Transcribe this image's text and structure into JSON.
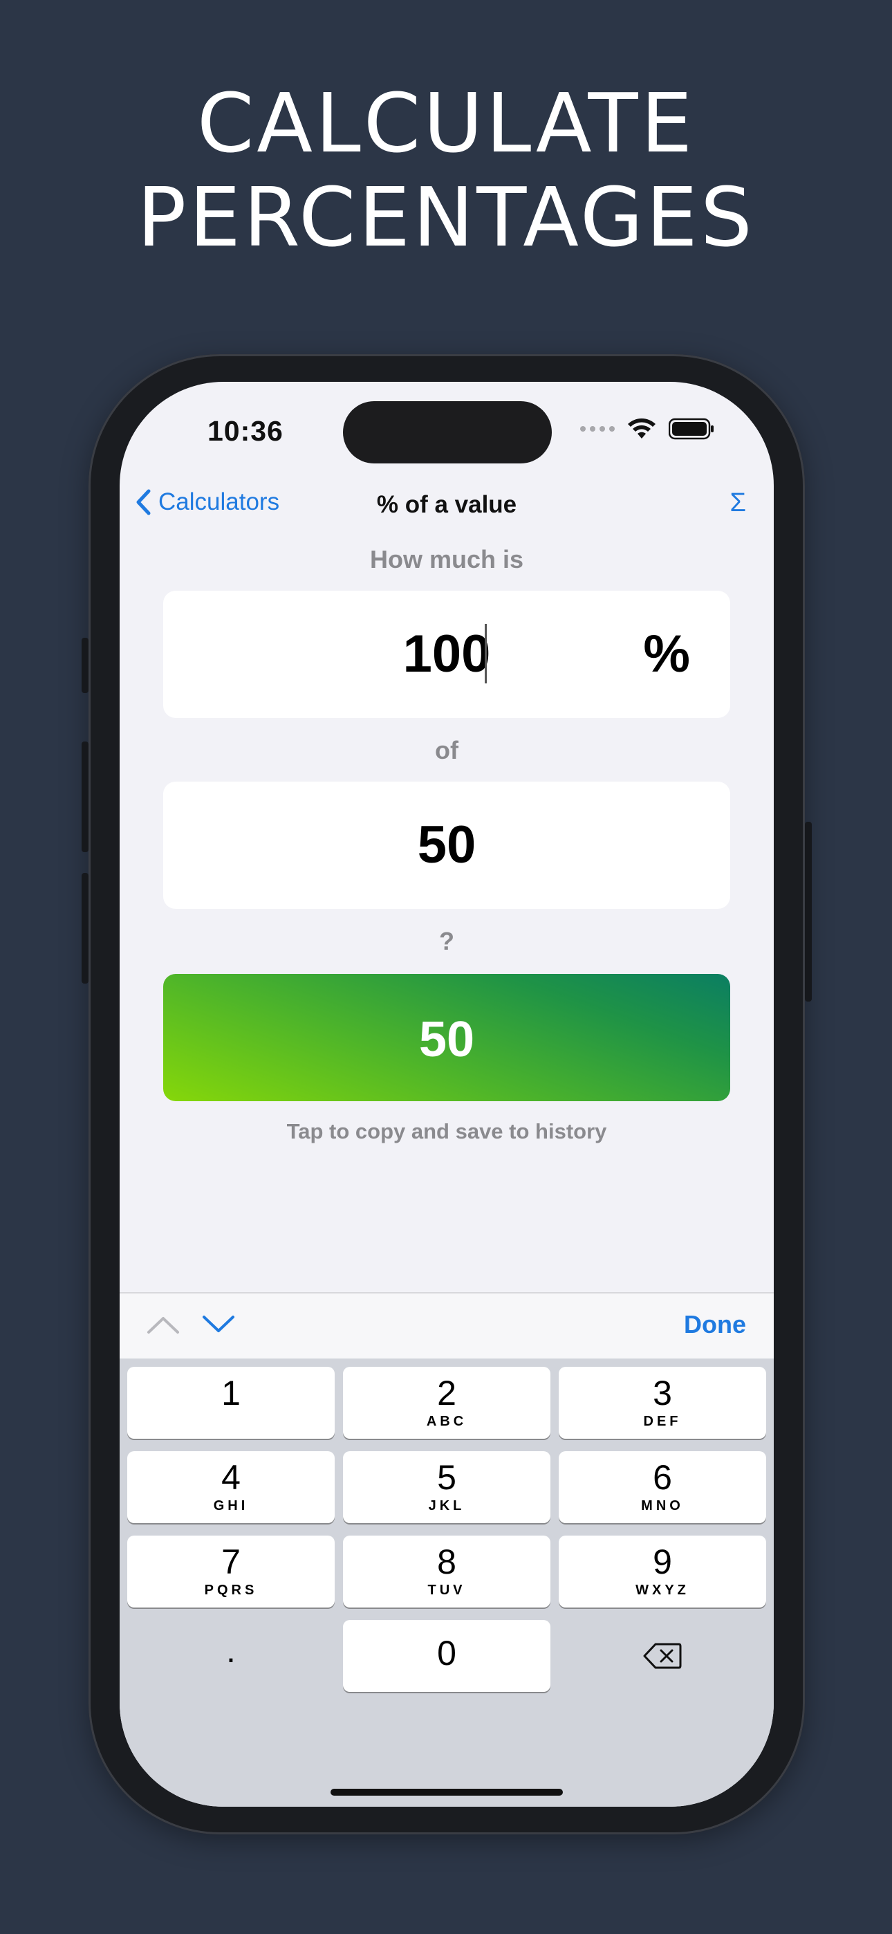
{
  "headline": {
    "line1": "CALCULATE",
    "line2": "PERCENTAGES"
  },
  "status_bar": {
    "time": "10:36"
  },
  "nav": {
    "back_label": "Calculators",
    "title": "% of a value",
    "sigma_label": "Σ"
  },
  "form": {
    "label_how_much": "How much is",
    "percent_value": "100",
    "percent_symbol": "%",
    "label_of": "of",
    "base_value": "50",
    "label_question": "?",
    "result_value": "50",
    "hint": "Tap to copy and save to history"
  },
  "keyboard": {
    "done_label": "Done",
    "keys": [
      {
        "num": "1",
        "sub": ""
      },
      {
        "num": "2",
        "sub": "ABC"
      },
      {
        "num": "3",
        "sub": "DEF"
      },
      {
        "num": "4",
        "sub": "GHI"
      },
      {
        "num": "5",
        "sub": "JKL"
      },
      {
        "num": "6",
        "sub": "MNO"
      },
      {
        "num": "7",
        "sub": "PQRS"
      },
      {
        "num": "8",
        "sub": "TUV"
      },
      {
        "num": "9",
        "sub": "WXYZ"
      },
      {
        "num": ".",
        "sub": ""
      },
      {
        "num": "0",
        "sub": ""
      }
    ]
  },
  "colors": {
    "background": "#2c3647",
    "accent": "#1f7ae0",
    "result_gradient_start": "#86d70a",
    "result_gradient_end": "#0b7e62",
    "screen_bg": "#f2f2f7"
  }
}
